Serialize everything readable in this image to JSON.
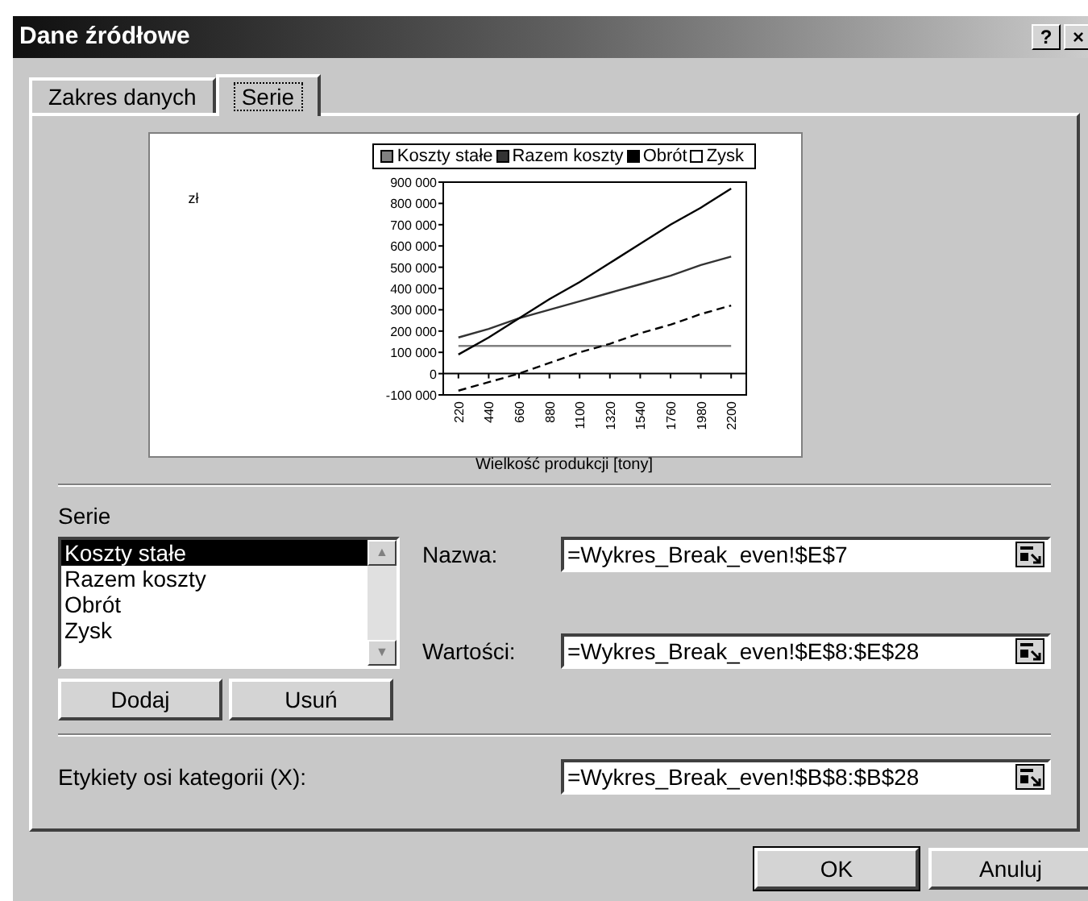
{
  "window": {
    "title": "Dane źródłowe",
    "buttons": [
      "?",
      "×"
    ]
  },
  "tabs": [
    {
      "label": "Zakres danych",
      "selected": false
    },
    {
      "label": "Serie",
      "selected": true
    }
  ],
  "preview": {
    "chart_data": {
      "type": "line",
      "xlabel": "Wielkość produkcji [tony]",
      "legend": "top",
      "annotations": [
        {
          "text": "zł"
        }
      ],
      "categories": [
        "220",
        "440",
        "660",
        "880",
        "1100",
        "1320",
        "1540",
        "1760",
        "1980",
        "2200"
      ],
      "series": [
        {
          "name": "Koszty stałe",
          "color": "#808080",
          "line_style": "solid",
          "values": [
            130000,
            130000,
            130000,
            130000,
            130000,
            130000,
            130000,
            130000,
            130000,
            130000
          ]
        },
        {
          "name": "Razem koszty",
          "color": "#333333",
          "line_style": "solid",
          "values": [
            170000,
            210000,
            260000,
            300000,
            340000,
            380000,
            420000,
            460000,
            510000,
            550000
          ]
        },
        {
          "name": "Obrót",
          "color": "#000000",
          "line_style": "solid",
          "values": [
            90000,
            170000,
            260000,
            350000,
            430000,
            520000,
            610000,
            700000,
            780000,
            870000
          ]
        },
        {
          "name": "Zysk",
          "color": "#000000",
          "line_style": "dashed",
          "values": [
            -80000,
            -40000,
            0,
            50000,
            100000,
            140000,
            190000,
            230000,
            280000,
            320000
          ]
        }
      ],
      "ylim": [
        -100000,
        900000
      ],
      "yticks": [
        {
          "value": -100000,
          "label": "-100 000"
        },
        {
          "value": 0,
          "label": "0"
        },
        {
          "value": 100000,
          "label": "100 000"
        },
        {
          "value": 200000,
          "label": "200 000"
        },
        {
          "value": 300000,
          "label": "300 000"
        },
        {
          "value": 400000,
          "label": "400 000"
        },
        {
          "value": 500000,
          "label": "500 000"
        },
        {
          "value": 600000,
          "label": "600 000"
        },
        {
          "value": 700000,
          "label": "700 000"
        },
        {
          "value": 800000,
          "label": "800 000"
        },
        {
          "value": 900000,
          "label": "900 000"
        }
      ]
    }
  },
  "series_section": {
    "label": "Serie",
    "items": [
      {
        "label": "Koszty stałe",
        "selected": true
      },
      {
        "label": "Razem koszty",
        "selected": false
      },
      {
        "label": "Obrót",
        "selected": false
      },
      {
        "label": "Zysk",
        "selected": false
      }
    ],
    "scroll_arrows": [
      "▲",
      "▼"
    ],
    "buttons": [
      "Dodaj",
      "Usuń"
    ],
    "fields": [
      {
        "label": "Nazwa:",
        "value": "=Wykres_Break_even!$E$7"
      },
      {
        "label": "Wartości:",
        "value": "=Wykres_Break_even!$E$8:$E$28"
      }
    ]
  },
  "category_field": {
    "label": "Etykiety osi kategorii (X):",
    "value": "=Wykres_Break_even!$B$8:$B$28"
  },
  "footer_buttons": [
    "OK",
    "Anuluj"
  ]
}
